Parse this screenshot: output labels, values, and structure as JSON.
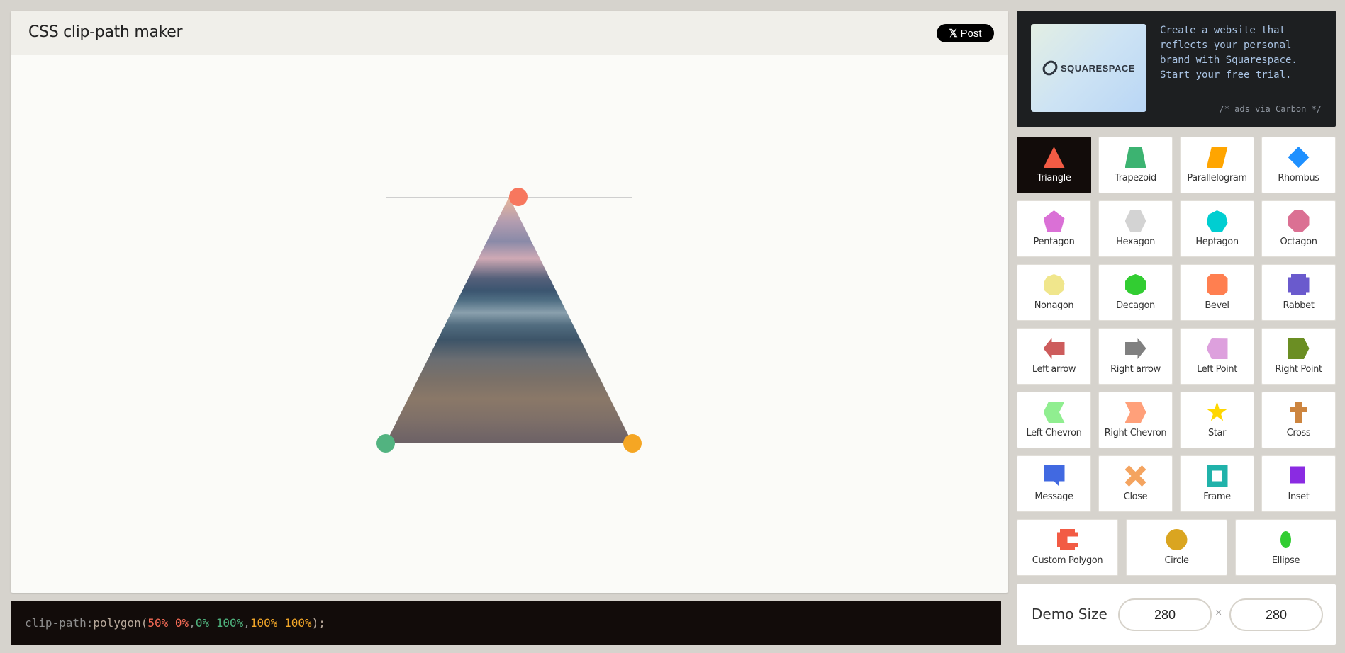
{
  "app": {
    "title": "CSS clip-path maker",
    "post_label": "Post"
  },
  "code": {
    "property": "clip-path: ",
    "fn_open": "polygon(",
    "p1": "50% 0%",
    "sep1": ", ",
    "p2": "0% 100%",
    "sep2": ", ",
    "p3": "100% 100%",
    "fn_close": ");"
  },
  "ad": {
    "brand": "SQUARESPACE",
    "text": "Create a website that reflects your personal brand with Squarespace. Start your free trial.",
    "via": "/* ads via Carbon */"
  },
  "shapes": [
    {
      "label": "Triangle",
      "color": "#f25b44",
      "active": true
    },
    {
      "label": "Trapezoid",
      "color": "#3cb371"
    },
    {
      "label": "Parallelogram",
      "color": "#ffa500"
    },
    {
      "label": "Rhombus",
      "color": "#1e90ff"
    },
    {
      "label": "Pentagon",
      "color": "#da70d6"
    },
    {
      "label": "Hexagon",
      "color": "#d3d3d3"
    },
    {
      "label": "Heptagon",
      "color": "#00ced1"
    },
    {
      "label": "Octagon",
      "color": "#db7093"
    },
    {
      "label": "Nonagon",
      "color": "#f0e68c"
    },
    {
      "label": "Decagon",
      "color": "#32cd32"
    },
    {
      "label": "Bevel",
      "color": "#ff7f50"
    },
    {
      "label": "Rabbet",
      "color": "#6a5acd"
    },
    {
      "label": "Left arrow",
      "color": "#cd5c5c"
    },
    {
      "label": "Right arrow",
      "color": "#808080"
    },
    {
      "label": "Left Point",
      "color": "#dda0dd"
    },
    {
      "label": "Right Point",
      "color": "#6b8e23"
    },
    {
      "label": "Left Chevron",
      "color": "#90ee90"
    },
    {
      "label": "Right Chevron",
      "color": "#ffa07a"
    },
    {
      "label": "Star",
      "color": "#ffd700"
    },
    {
      "label": "Cross",
      "color": "#cd853f"
    },
    {
      "label": "Message",
      "color": "#4169e1"
    },
    {
      "label": "Close",
      "color": "#f4a460"
    },
    {
      "label": "Frame",
      "color": "#20b2aa"
    },
    {
      "label": "Inset",
      "color": "#8a2be2"
    },
    {
      "label": "Custom Polygon",
      "color": "#f25b44"
    },
    {
      "label": "Circle",
      "color": "#daa520"
    },
    {
      "label": "Ellipse",
      "color": "#32cd32"
    }
  ],
  "demo_size": {
    "label": "Demo Size",
    "width": "280",
    "height": "280",
    "times": "×"
  },
  "handles": [
    {
      "name": "handle-1",
      "color": "#f7775e"
    },
    {
      "name": "handle-2",
      "color": "#52b380"
    },
    {
      "name": "handle-3",
      "color": "#f5a623"
    }
  ]
}
